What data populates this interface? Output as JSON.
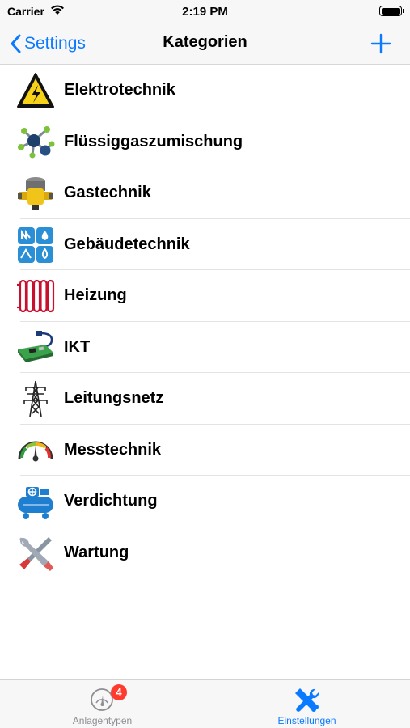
{
  "status_bar": {
    "carrier": "Carrier",
    "time": "2:19 PM"
  },
  "nav": {
    "back_label": "Settings",
    "title": "Kategorien",
    "add_icon": "plus-icon"
  },
  "categories": [
    {
      "label": "Elektrotechnik",
      "icon": "high-voltage-warning-icon"
    },
    {
      "label": "Flüssiggaszumischung",
      "icon": "molecule-icon"
    },
    {
      "label": "Gastechnik",
      "icon": "gas-regulator-icon"
    },
    {
      "label": "Gebäudetechnik",
      "icon": "building-services-icon"
    },
    {
      "label": "Heizung",
      "icon": "radiator-icon"
    },
    {
      "label": "IKT",
      "icon": "circuit-board-icon"
    },
    {
      "label": "Leitungsnetz",
      "icon": "power-pylon-icon"
    },
    {
      "label": "Messtechnik",
      "icon": "gauge-icon"
    },
    {
      "label": "Verdichtung",
      "icon": "compressor-icon"
    },
    {
      "label": "Wartung",
      "icon": "wrench-screwdriver-icon"
    }
  ],
  "tabs": [
    {
      "label": "Anlagentypen",
      "badge": "4",
      "icon": "gauge-icon",
      "active": false
    },
    {
      "label": "Einstellungen",
      "badge": "",
      "icon": "tools-icon",
      "active": true
    }
  ],
  "colors": {
    "accent": "#0a7aff",
    "badge": "#ff3b30",
    "inactive_tab": "#8e8e93"
  }
}
